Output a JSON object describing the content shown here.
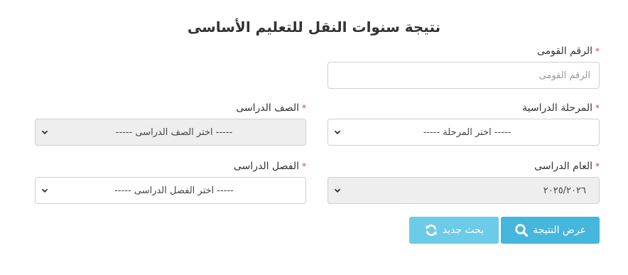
{
  "page": {
    "title": "نتيجة سنوات النقل للتعليم الأساسى",
    "required_mark": "*"
  },
  "form": {
    "national_id": {
      "label": "الرقم القومى",
      "placeholder": "الرقم القومى",
      "value": ""
    },
    "stage": {
      "label": "المرحلة الدراسية",
      "selected": "----- اختر المرحلة -----"
    },
    "grade": {
      "label": "الصف الدراسى",
      "selected": "----- اختر الصف الدراسى -----"
    },
    "academic_year": {
      "label": "العام الدراسى",
      "selected": "٢٠٢٥/٢٠٢٦"
    },
    "class": {
      "label": "الفصل الدراسى",
      "selected": "----- اختر الفصل الدراسى -----"
    }
  },
  "buttons": {
    "show_result": {
      "label": "عرض النتيجة",
      "icon": "search-icon"
    },
    "new_search": {
      "label": "بحث جديد",
      "icon": "refresh-icon"
    }
  },
  "colors": {
    "primary_button": "#45b6dc",
    "secondary_button": "#6ccbe8",
    "required": "#e53935",
    "disabled_field": "#eeeeee"
  }
}
